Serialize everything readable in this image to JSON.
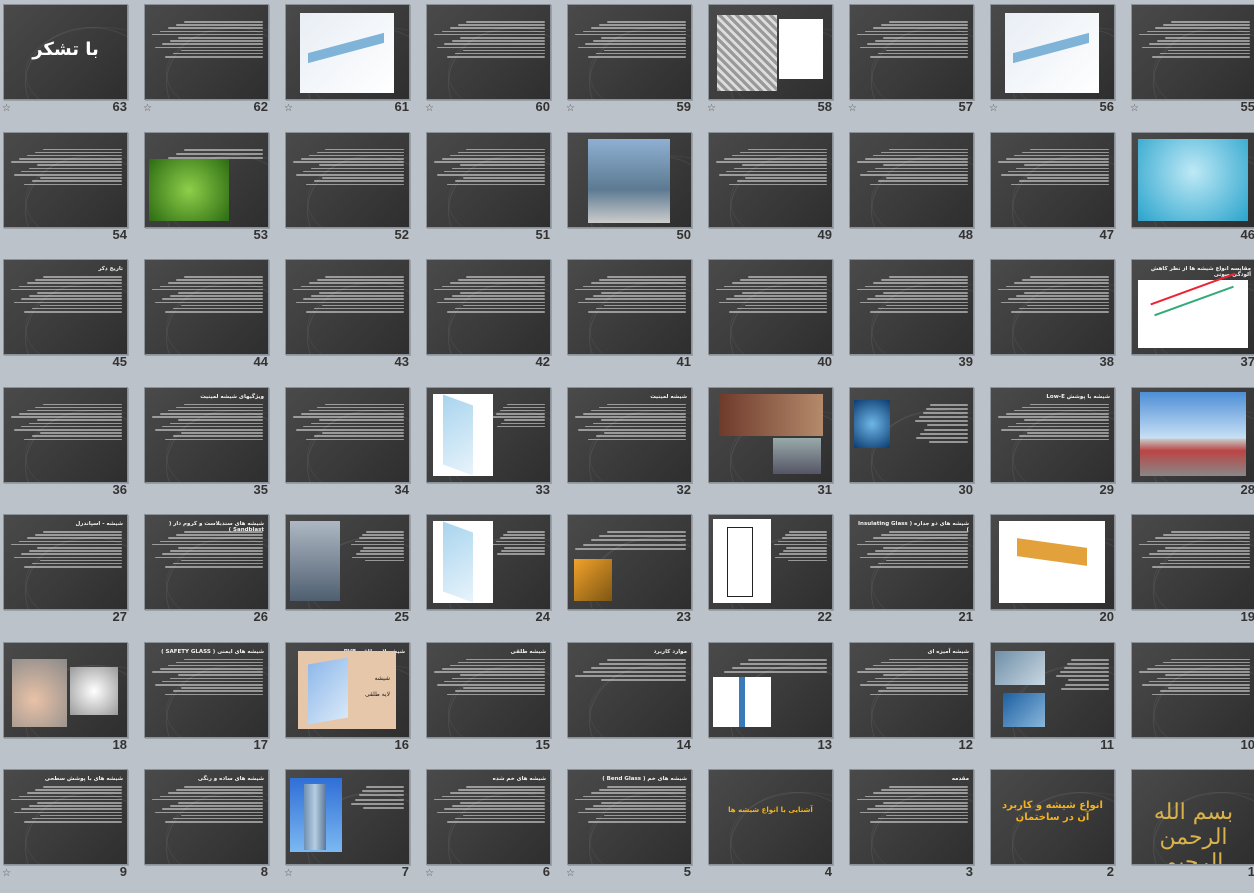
{
  "view": "slide-sorter",
  "slides": [
    {
      "n": "63",
      "title": "با تشکر",
      "kind": "thanks"
    },
    {
      "n": "62",
      "title": "",
      "kind": "text"
    },
    {
      "n": "61",
      "title": "",
      "kind": "diagram-light"
    },
    {
      "n": "60",
      "title": "",
      "kind": "text"
    },
    {
      "n": "59",
      "title": "",
      "kind": "text"
    },
    {
      "n": "58",
      "title": "",
      "kind": "photo-micro"
    },
    {
      "n": "57",
      "title": "",
      "kind": "text"
    },
    {
      "n": "56",
      "title": "",
      "kind": "diagram-light"
    },
    {
      "n": "55",
      "title": "",
      "kind": "text"
    },
    {
      "n": "54",
      "title": "",
      "kind": "text"
    },
    {
      "n": "53",
      "title": "",
      "kind": "photo-leaf"
    },
    {
      "n": "52",
      "title": "",
      "kind": "text"
    },
    {
      "n": "51",
      "title": "",
      "kind": "text"
    },
    {
      "n": "50",
      "title": "",
      "kind": "photo-city"
    },
    {
      "n": "49",
      "title": "",
      "kind": "text"
    },
    {
      "n": "48",
      "title": "",
      "kind": "text"
    },
    {
      "n": "47",
      "title": "",
      "kind": "text"
    },
    {
      "n": "46",
      "title": "",
      "kind": "photo-crack"
    },
    {
      "n": "45",
      "title": "تاریخ ذکر",
      "kind": "text"
    },
    {
      "n": "44",
      "title": "",
      "kind": "text"
    },
    {
      "n": "43",
      "title": "",
      "kind": "text"
    },
    {
      "n": "42",
      "title": "",
      "kind": "text"
    },
    {
      "n": "41",
      "title": "",
      "kind": "text"
    },
    {
      "n": "40",
      "title": "",
      "kind": "text"
    },
    {
      "n": "39",
      "title": "",
      "kind": "text"
    },
    {
      "n": "38",
      "title": "",
      "kind": "text"
    },
    {
      "n": "37",
      "title": "مقایسه انواع شیشه ها از نظر کاهش آلودگی صوتی",
      "kind": "chart-light"
    },
    {
      "n": "36",
      "title": "",
      "kind": "text"
    },
    {
      "n": "35",
      "title": "ویژگیهای شیشه لمینیت",
      "kind": "text"
    },
    {
      "n": "34",
      "title": "",
      "kind": "text"
    },
    {
      "n": "33",
      "title": "",
      "kind": "diagram-glass"
    },
    {
      "n": "32",
      "title": "شیشه لمینیت",
      "kind": "text"
    },
    {
      "n": "31",
      "title": "",
      "kind": "photo-shop"
    },
    {
      "n": "30",
      "title": "",
      "kind": "photo-shatter"
    },
    {
      "n": "29",
      "title": "شیشه با پوشش Low-E",
      "kind": "text"
    },
    {
      "n": "28",
      "title": "",
      "kind": "photo-sky"
    },
    {
      "n": "27",
      "title": "شیشه - اسپاندرل",
      "kind": "text"
    },
    {
      "n": "26",
      "title": "شیشه های سندبلاست و کروم دار ( Sandblast )",
      "kind": "text"
    },
    {
      "n": "25",
      "title": "",
      "kind": "photo-building"
    },
    {
      "n": "24",
      "title": "",
      "kind": "diagram-glass"
    },
    {
      "n": "23",
      "title": "",
      "kind": "photo-window"
    },
    {
      "n": "22",
      "title": "",
      "kind": "drawing"
    },
    {
      "n": "21",
      "title": "شیشه های دو جداره ( Insulating Glass )",
      "kind": "text"
    },
    {
      "n": "20",
      "title": "",
      "kind": "diagram-frame"
    },
    {
      "n": "19",
      "title": "",
      "kind": "text"
    },
    {
      "n": "18",
      "title": "",
      "kind": "photo-hand"
    },
    {
      "n": "17",
      "title": "شیشه های ایمنی ( SAFETY GLASS )",
      "kind": "text"
    },
    {
      "n": "16",
      "title": "شیشه  لایه طلقی PVB",
      "kind": "diagram-pvb"
    },
    {
      "n": "15",
      "title": "شیشه  طلقی",
      "kind": "text"
    },
    {
      "n": "14",
      "title": "موارد کاربرد",
      "kind": "list"
    },
    {
      "n": "13",
      "title": "",
      "kind": "diagram-glass-small"
    },
    {
      "n": "12",
      "title": "شیشه آمیزه ای",
      "kind": "text"
    },
    {
      "n": "11",
      "title": "",
      "kind": "photo-facade"
    },
    {
      "n": "10",
      "title": "",
      "kind": "text"
    },
    {
      "n": "9",
      "title": "شیشه های با پوشش سطحی",
      "kind": "text"
    },
    {
      "n": "8",
      "title": "شیشه های ساده و رنگی",
      "kind": "text"
    },
    {
      "n": "7",
      "title": "",
      "kind": "photo-tower"
    },
    {
      "n": "6",
      "title": "شیشه های خم شده",
      "kind": "text"
    },
    {
      "n": "5",
      "title": "شیشه های خم ( Bend Glass )",
      "kind": "text"
    },
    {
      "n": "4",
      "title": "آشنایی با انواع شیشه ها",
      "kind": "section"
    },
    {
      "n": "3",
      "title": "مقدمه",
      "kind": "text"
    },
    {
      "n": "2",
      "title": "انواع شیشه و کاربرد آن در ساختمان",
      "kind": "cover"
    },
    {
      "n": "1",
      "title": "بسم الله الرحمن الرحیم",
      "kind": "bismillah"
    }
  ],
  "star_marks": [
    "9",
    "7",
    "6",
    "5",
    "63",
    "62",
    "61",
    "60",
    "59",
    "58",
    "57",
    "56",
    "55"
  ],
  "colors": {
    "accent": "#f4a21a",
    "slide_bg": "#3b3b3b",
    "sorter_bg": "#bcc2c9"
  }
}
